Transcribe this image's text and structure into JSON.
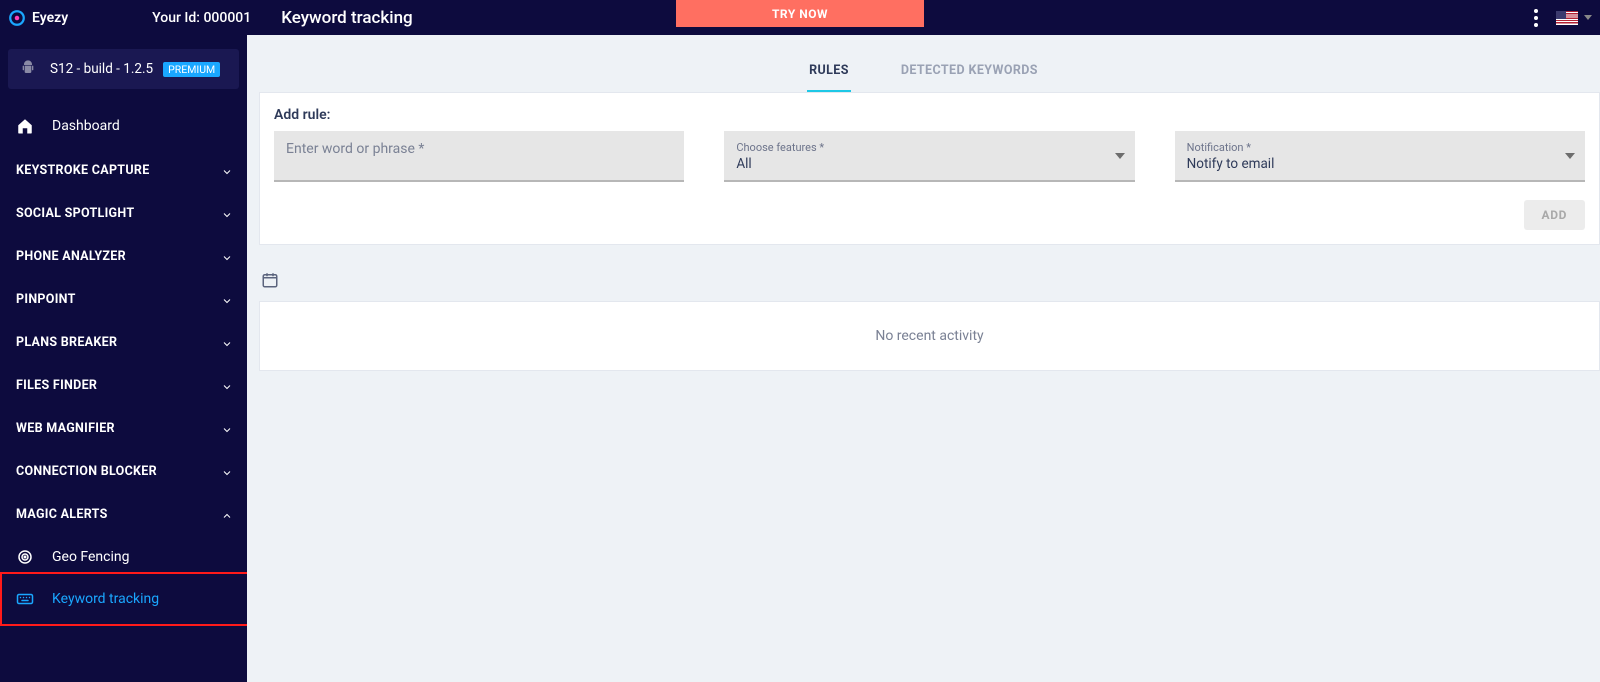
{
  "brand": "Eyezy",
  "header": {
    "user_id_label": "Your Id: 000001",
    "page_title": "Keyword tracking",
    "cta": "TRY NOW"
  },
  "sidebar": {
    "device": {
      "name": "S12 - build - 1.2.5",
      "badge": "PREMIUM"
    },
    "dashboard": "Dashboard",
    "groups": [
      {
        "label": "KEYSTROKE CAPTURE",
        "expanded": false
      },
      {
        "label": "SOCIAL SPOTLIGHT",
        "expanded": false
      },
      {
        "label": "PHONE ANALYZER",
        "expanded": false
      },
      {
        "label": "PINPOINT",
        "expanded": false
      },
      {
        "label": "PLANS BREAKER",
        "expanded": false
      },
      {
        "label": "FILES FINDER",
        "expanded": false
      },
      {
        "label": "WEB MAGNIFIER",
        "expanded": false
      },
      {
        "label": "CONNECTION BLOCKER",
        "expanded": false
      },
      {
        "label": "MAGIC ALERTS",
        "expanded": true
      }
    ],
    "magic_alerts": {
      "geo": "Geo Fencing",
      "keyword": "Keyword tracking"
    }
  },
  "tabs": {
    "rules": "RULES",
    "detected": "DETECTED KEYWORDS"
  },
  "form": {
    "title": "Add rule:",
    "word_placeholder": "Enter word or phrase *",
    "features_label": "Choose features *",
    "features_value": "All",
    "notification_label": "Notification *",
    "notification_value": "Notify to email",
    "add_btn": "ADD"
  },
  "activity": {
    "empty": "No recent activity"
  }
}
